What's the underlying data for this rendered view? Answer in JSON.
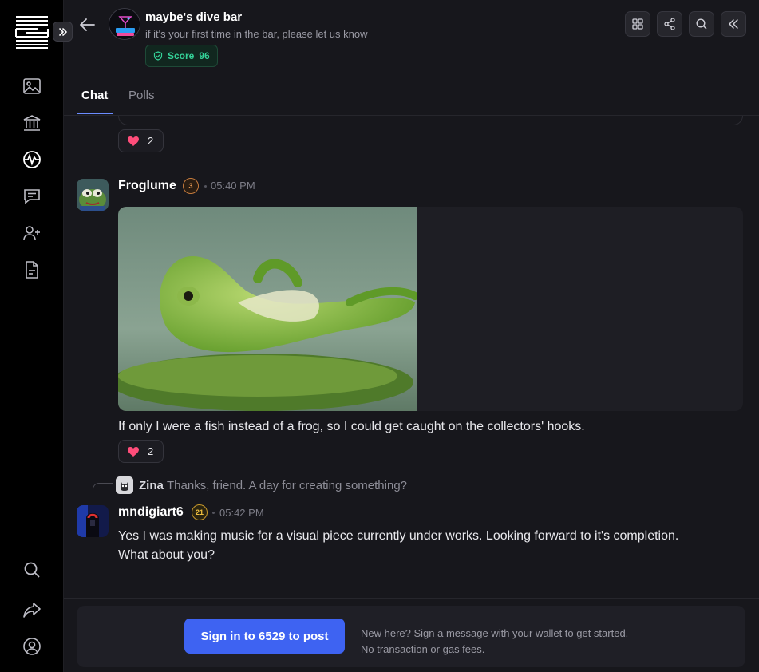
{
  "header": {
    "bar_name": "maybe's dive bar",
    "bar_desc": "if it's your first time in the bar, please let us know",
    "score_label": "Score",
    "score_value": "96",
    "buttons": [
      "grid-icon",
      "share-icon",
      "search-icon",
      "collapse-icon"
    ]
  },
  "sidebar": {
    "logo": "stacked-lines-logo",
    "top_items": [
      "gallery-icon",
      "bank-icon",
      "activity-globe-icon",
      "chat-icon",
      "add-user-icon",
      "document-icon"
    ],
    "bottom_items": [
      "search-icon",
      "forward-icon",
      "profile-icon"
    ]
  },
  "tabs": {
    "items": [
      "Chat",
      "Polls"
    ],
    "active": "Chat"
  },
  "messages": [
    {
      "reaction_count": "2"
    },
    {
      "username": "Froglume",
      "level": "3",
      "time": "05:40 PM",
      "text": "If only I were a fish instead of a frog, so I could get caught on the collectors' hooks.",
      "reaction_count": "2"
    },
    {
      "reply_name": "Zina",
      "reply_text": "Thanks, friend. A day for creating something?",
      "username": "mndigiart6",
      "level": "21",
      "time": "05:42 PM",
      "text_line1": "Yes I was making music for a visual piece currently under works. Looking forward to it's completion.",
      "text_line2": "What about you?"
    }
  ],
  "footer": {
    "signin_label": "Sign in to 6529 to post",
    "note_line1": "New here? Sign a message with your wallet to get started.",
    "note_line2": "No transaction or gas fees."
  },
  "colors": {
    "accent": "#3e63f2",
    "tab_underline": "#6b8cff",
    "score_green": "#34d399",
    "heart": "#ff4d7a"
  }
}
